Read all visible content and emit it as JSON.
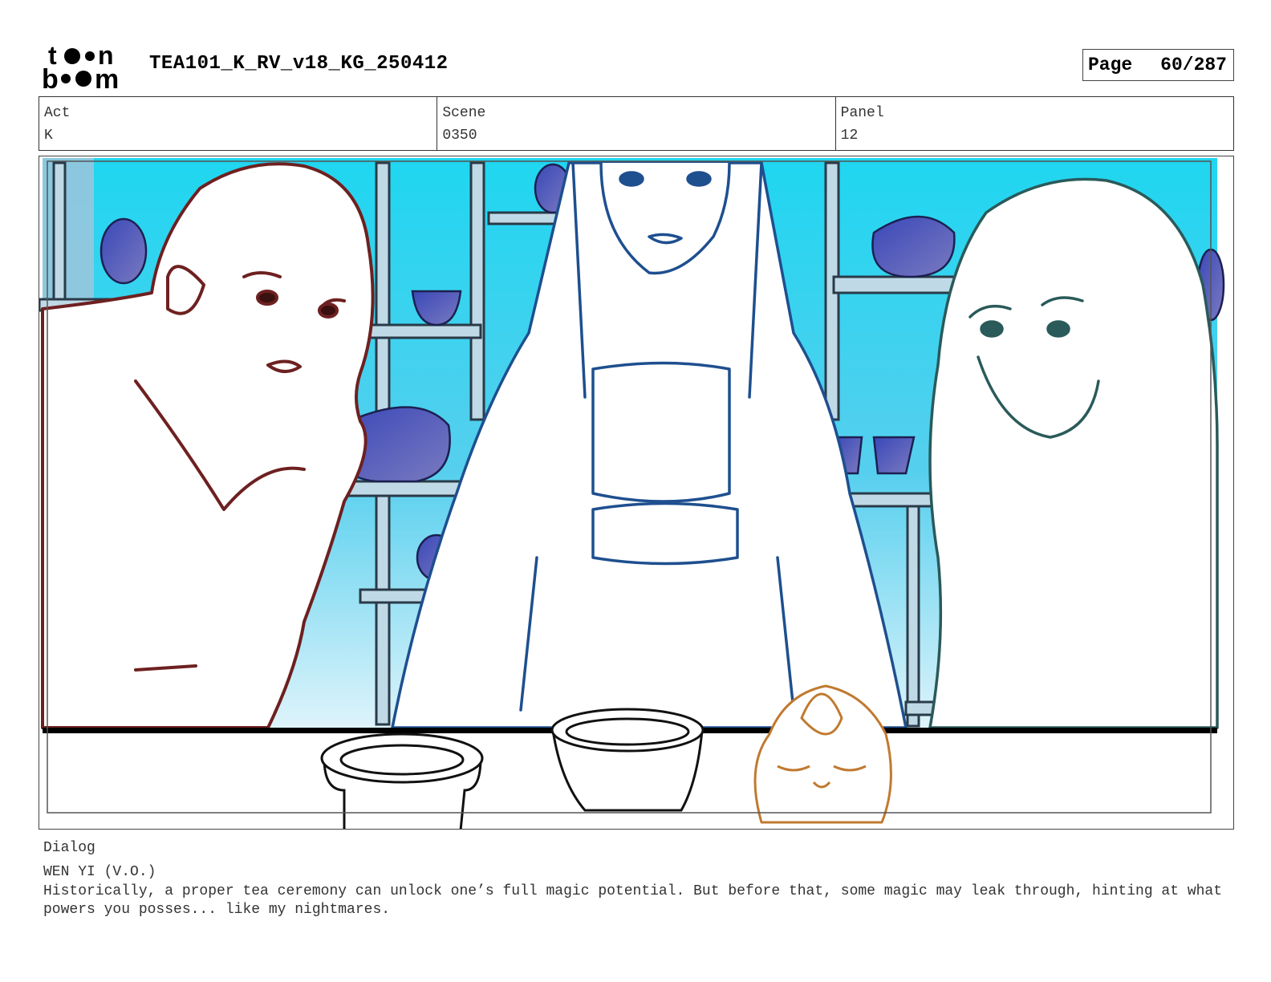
{
  "header": {
    "logo_text": "toon boom",
    "title": "TEA101_K_RV_v18_KG_250412",
    "page_label": "Page",
    "page_value": "60/287"
  },
  "info": {
    "act_label": "Act",
    "act_value": "K",
    "scene_label": "Scene",
    "scene_value": "0350",
    "panel_label": "Panel",
    "panel_value": "12"
  },
  "dialog": {
    "heading": "Dialog",
    "speaker": "WEN YI (V.O.)",
    "text": "Historically, a proper tea ceremony can unlock one’s full magic potential. But before that, some magic may leak through, hinting at what powers you posses... like my nightmares."
  },
  "colors": {
    "left_character_line": "#6e2020",
    "center_character_line": "#1e4f8f",
    "right_character_line": "#2a5a5a",
    "creature_line": "#c07a30",
    "background_cyan": "#1fd6f0",
    "teaware_blue": "#4a4fb0"
  }
}
